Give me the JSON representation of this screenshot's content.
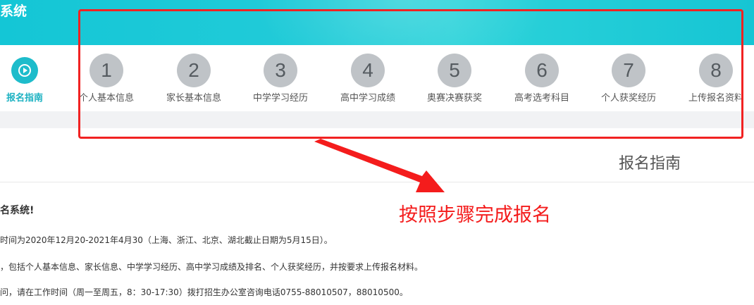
{
  "header": {
    "title": "系统"
  },
  "steps": [
    {
      "number": "",
      "label": "报名指南"
    },
    {
      "number": "1",
      "label": "个人基本信息"
    },
    {
      "number": "2",
      "label": "家长基本信息"
    },
    {
      "number": "3",
      "label": "中学学习经历"
    },
    {
      "number": "4",
      "label": "高中学习成绩"
    },
    {
      "number": "5",
      "label": "奥赛决赛获奖"
    },
    {
      "number": "6",
      "label": "高考选考科目"
    },
    {
      "number": "7",
      "label": "个人获奖经历"
    },
    {
      "number": "8",
      "label": "上传报名资料"
    }
  ],
  "main": {
    "guide_title": "报名指南",
    "welcome": "名系统!",
    "lines": [
      "时间为2020年12月20-2021年4月30（上海、浙江、北京、湖北截止日期为5月15日）。",
      "，包括个人基本信息、家长信息、中学学习经历、高中学习成绩及排名、个人获奖经历，并按要求上传报名材料。",
      "问，请在工作时间（周一至周五，8：30-17:30）拨打招生办公室咨询电话0755-88010507，88010500。"
    ]
  },
  "annotation": {
    "text": "按照步骤完成报名",
    "color": "#f12222"
  },
  "colors": {
    "header": "#1fc9d6",
    "active": "#1dbccb",
    "inactive": "#bfc3c7"
  }
}
